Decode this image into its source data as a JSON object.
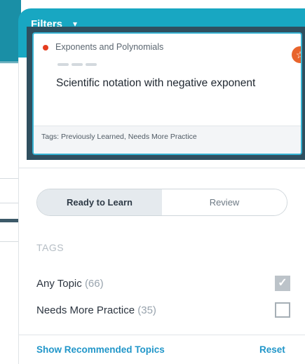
{
  "filters": {
    "label": "Filters",
    "caret": "▾"
  },
  "card": {
    "category": "Exponents and Polynomials",
    "title": "Scientific notation with negative exponent",
    "tags": "Tags: Previously Learned, Needs More Practice",
    "badge_icon": "star-icon",
    "category_color": "#e53d1f"
  },
  "toggle": {
    "options": [
      {
        "label": "Ready to Learn",
        "active": true
      },
      {
        "label": "Review",
        "active": false
      }
    ]
  },
  "tags_section": {
    "title": "TAGS",
    "items": [
      {
        "label": "Any Topic",
        "count": "(66)",
        "checked": true
      },
      {
        "label": "Needs More Practice",
        "count": "(35)",
        "checked": false
      }
    ]
  },
  "footer": {
    "show_recommended": "Show Recommended Topics",
    "reset": "Reset"
  },
  "colors": {
    "accent": "#18a7c2",
    "link": "#2196c9",
    "badge": "#e8642c"
  }
}
